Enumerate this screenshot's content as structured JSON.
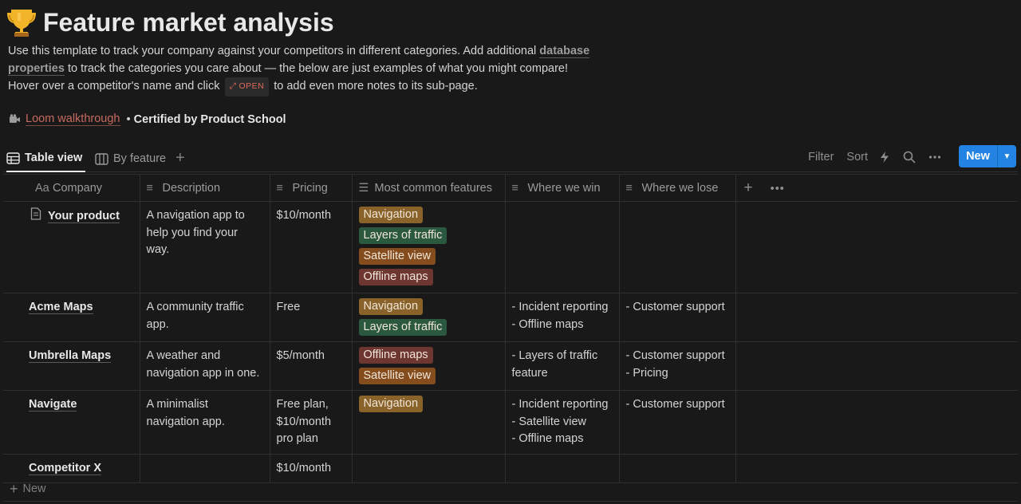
{
  "page": {
    "title": "Feature market analysis",
    "desc_part1": "Use this template to track your company against your competitors in different categories. Add additional ",
    "desc_link": "database properties",
    "desc_part2": " to track the categories you care about — the below are just examples of what you might compare!",
    "desc_line2_a": "Hover over a competitor's name and click ",
    "open_chip": "OPEN",
    "desc_line2_b": " to add even more notes to its sub-page.",
    "loom_link": "Loom walkthrough",
    "loom_sep": " • ",
    "certified": "Certified by Product School"
  },
  "views": {
    "tab_table": "Table view",
    "tab_feature": "By feature",
    "add": "+",
    "filter": "Filter",
    "sort": "Sort",
    "new_label": "New"
  },
  "columns": {
    "company": "Company",
    "company_icon": "Aa",
    "description": "Description",
    "pricing": "Pricing",
    "features": "Most common features",
    "win": "Where we win",
    "lose": "Where we lose"
  },
  "colors": {
    "Navigation": "#89632a",
    "Layers of traffic": "#2b593f",
    "Satellite view": "#854c1d",
    "Offline maps": "#6e3630",
    "accent": "#2383e2"
  },
  "rows": [
    {
      "name": "Your product",
      "description": "A navigation app to help you find your way.",
      "pricing": "$10/month",
      "features": [
        "Navigation",
        "Layers of traffic",
        "Satellite view",
        "Offline maps"
      ],
      "win": "",
      "lose": ""
    },
    {
      "name": "Acme Maps",
      "description": "A community traffic app.",
      "pricing": "Free",
      "features": [
        "Navigation",
        "Layers of traffic"
      ],
      "win": "- Incident reporting\n- Offline maps",
      "lose": "- Customer support"
    },
    {
      "name": "Umbrella Maps",
      "description": "A weather and navigation app in one.",
      "pricing": "$5/month",
      "features": [
        "Offline maps",
        "Satellite view"
      ],
      "win": "- Layers of traffic\nfeature",
      "lose": "- Customer support\n- Pricing"
    },
    {
      "name": "Navigate",
      "description": "A minimalist navigation app.",
      "pricing": "Free plan,\n$10/month\npro plan",
      "features": [
        "Navigation"
      ],
      "win": "- Incident reporting\n- Satellite view\n- Offline maps",
      "lose": "- Customer support"
    },
    {
      "name": "Competitor X",
      "description": "",
      "pricing": "$10/month",
      "features": [],
      "win": "",
      "lose": ""
    }
  ],
  "new_row": "New"
}
